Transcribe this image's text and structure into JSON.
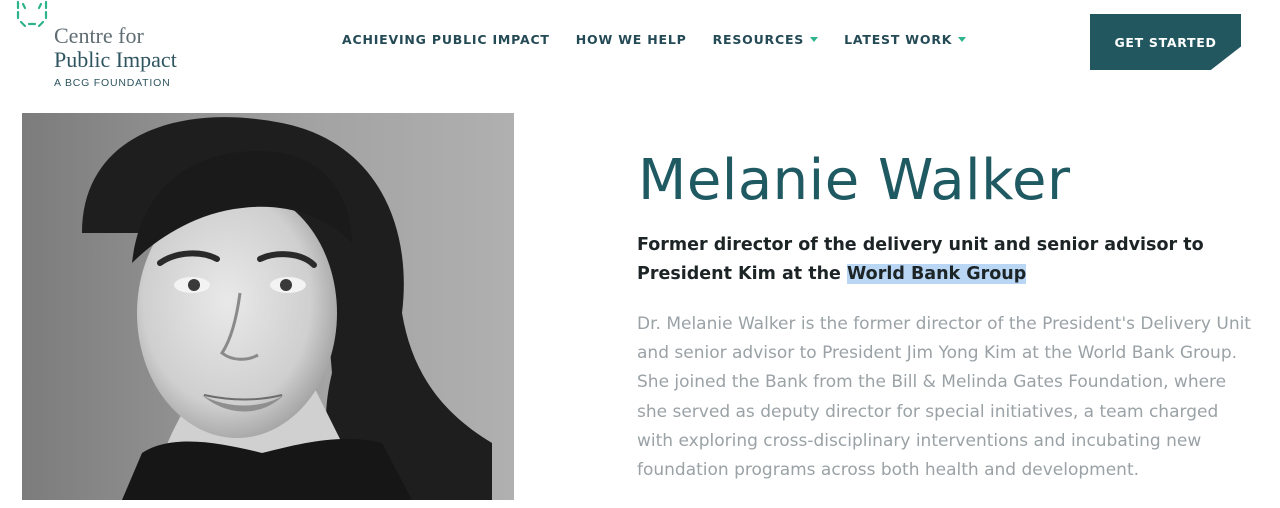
{
  "brand": {
    "line1": "Centre for",
    "line2": "Public Impact",
    "sub": "A BCG FOUNDATION",
    "accent": "#2fb38c"
  },
  "nav": {
    "items": [
      {
        "label": "ACHIEVING PUBLIC IMPACT",
        "dropdown": false
      },
      {
        "label": "HOW WE HELP",
        "dropdown": false
      },
      {
        "label": "RESOURCES",
        "dropdown": true
      },
      {
        "label": "LATEST WORK",
        "dropdown": true
      }
    ],
    "cta": "GET STARTED",
    "cta_color": "#235760"
  },
  "profile": {
    "name": "Melanie Walker",
    "title_before": "Former director of the delivery unit and senior advisor to President Kim at the ",
    "title_highlight": "World Bank Group",
    "bio": "Dr. Melanie Walker is the former director of the President's Delivery Unit and senior advisor to President Jim Yong Kim at the World Bank Group. She joined the Bank from the Bill & Melinda Gates Foundation, where she served as deputy director for special initiatives, a team charged with exploring cross-disciplinary interventions and incubating new foundation programs across both health and development.",
    "name_color": "#1f5a63"
  }
}
